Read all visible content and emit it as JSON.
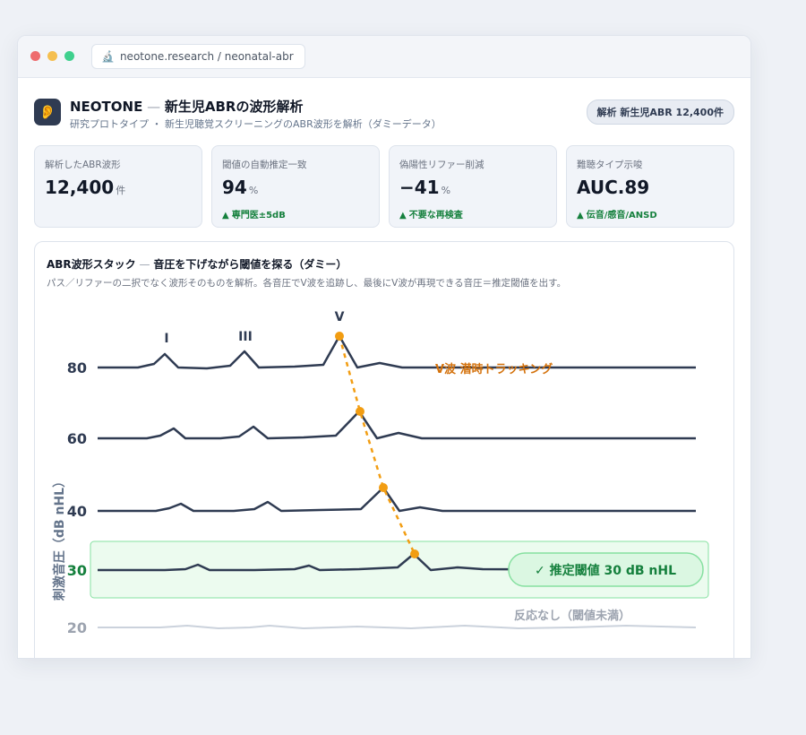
{
  "browser": {
    "url": "neotone.research / neonatal-abr",
    "url_icon": "microscope-icon"
  },
  "header": {
    "logo_icon": "ear-icon",
    "title_brand": "NEOTONE",
    "title_sep": " — ",
    "title_rest": "新生児ABRの波形解析",
    "subtitle": "研究プロトタイプ ・ 新生児聴覚スクリーニングのABR波形を解析（ダミーデータ）",
    "badge": "解析 新生児ABR 12,400件"
  },
  "kpis": [
    {
      "label": "解析したABR波形",
      "value": "12,400",
      "unit": "件",
      "delta": ""
    },
    {
      "label": "閾値の自動推定一致",
      "value": "94",
      "unit": "%",
      "delta": "専門医±5dB"
    },
    {
      "label": "偽陽性リファー削減",
      "value": "−41",
      "unit": "%",
      "delta": "不要な再検査"
    },
    {
      "label": "難聴タイプ示唆",
      "value": "AUC.89",
      "unit": "",
      "delta": "伝音/感音/ANSD"
    }
  ],
  "colors": {
    "wave": "#2f3b52",
    "wave_faint": "#cbd2dc",
    "v_track": "#f29d12",
    "v_track_label": "#d4720c",
    "threshold_fill": "#ecfbef",
    "threshold_stroke": "#86e0a0",
    "threshold_text": "#15803d",
    "axis_label": "#2f3b52",
    "axis_label_faint": "#9ca3af",
    "delta_green": "#15803d"
  },
  "panel": {
    "title": "ABR波形スタック",
    "title_sep": " — ",
    "title_rest": "音圧を下げながら閾値を探る（ダミー）",
    "subtitle": "パス／リファーの二択でなく波形そのものを解析。各音圧でV波を追跡し、最後にV波が再現できる音圧＝推定閾値を出す。"
  },
  "chart_data": {
    "type": "line",
    "ylabel": "刺激音圧（dB nHL）",
    "levels": [
      80,
      60,
      40,
      30,
      20
    ],
    "wave_labels": [
      "I",
      "III",
      "V"
    ],
    "v_track_label": "V波 潜時トラッキング",
    "threshold_level": 30,
    "threshold_label": "✓ 推定閾値 30 dB nHL",
    "no_response_label": "反応なし（閾値未満）",
    "no_response_level": 20
  }
}
